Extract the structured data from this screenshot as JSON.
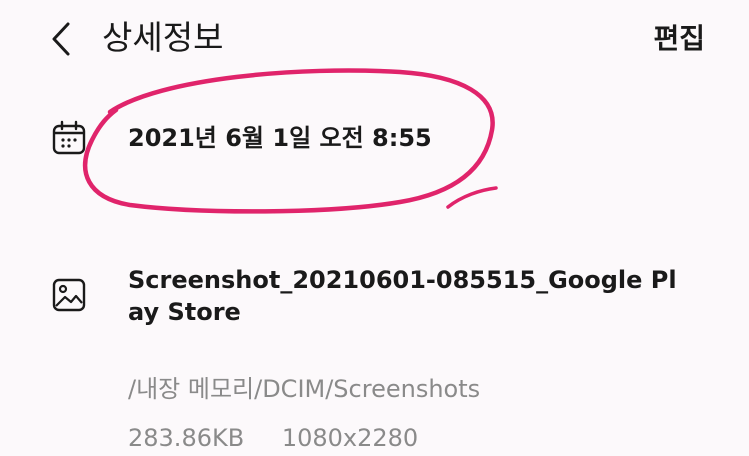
{
  "header": {
    "back_icon": "chevron-left-icon",
    "title": "상세정보",
    "edit_label": "편집"
  },
  "details": {
    "date_icon": "calendar-icon",
    "date": "2021년 6월 1일 오전 8:55",
    "image_icon": "image-icon",
    "file_name": "Screenshot_20210601-085515_Google Play Store",
    "path": "/내장 메모리/DCIM/Screenshots",
    "size": "283.86KB",
    "resolution": "1080x2280"
  },
  "colors": {
    "background": "#fcf9fb",
    "primary_text": "#1a1a1a",
    "secondary_text": "#8a8a8a",
    "annotation": "#e0246b"
  }
}
